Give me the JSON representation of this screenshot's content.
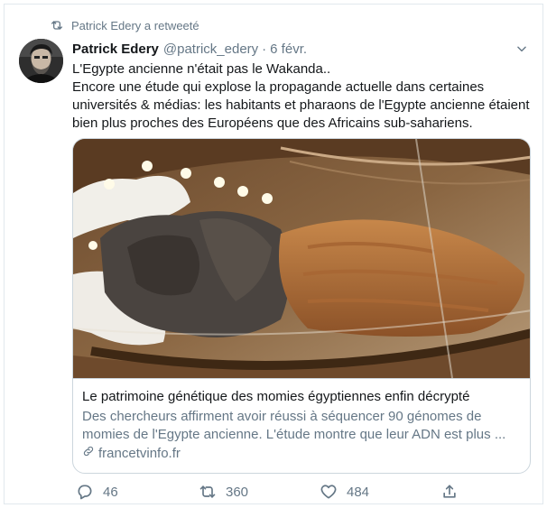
{
  "retweet_banner": {
    "text": "Patrick Edery a retweeté",
    "icon": "retweet-icon"
  },
  "author": {
    "name": "Patrick Edery",
    "handle": "@patrick_edery",
    "separator": "·",
    "date": "6 févr."
  },
  "tweet": {
    "lines": [
      "L'Egypte ancienne n'était pas le Wakanda..",
      "Encore une étude qui explose la propagande actuelle dans certaines",
      "universités & médias: les habitants et pharaons de l'Egypte ancienne étaient",
      "bien plus proches des Européens que des Africains sub-sahariens."
    ]
  },
  "card": {
    "title": "Le patrimoine génétique des momies égyptiennes enfin décrypté",
    "description_lines": [
      "Des chercheurs affirment avoir réussi à séquencer 90 génomes de",
      "momies de l'Egypte ancienne. L'étude montre que leur ADN est plus ..."
    ],
    "domain": "francetvinfo.fr",
    "image_description_icon": "mummy-photo"
  },
  "actions": {
    "reply_count": "46",
    "retweet_count": "360",
    "like_count": "484"
  },
  "colors": {
    "text_primary": "#14171a",
    "text_secondary": "#657786",
    "border": "#e1e8ed",
    "card_border": "#ccd6dd"
  }
}
